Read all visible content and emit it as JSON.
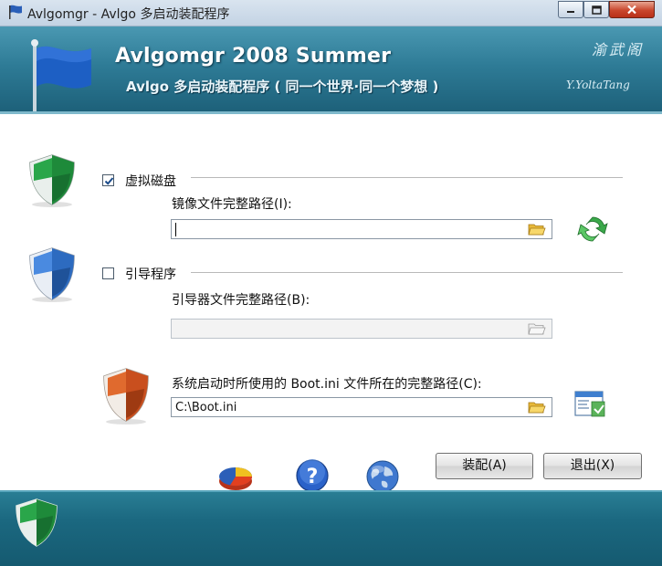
{
  "window": {
    "title": "Avlgomgr - Avlgo 多启动装配程序",
    "controls": [
      "minimize",
      "maximize",
      "close"
    ]
  },
  "banner": {
    "title": "Avlgomgr 2008 Summer",
    "subtitle": "Avlgo 多启动装配程序 ( 同一个世界·同一个梦想 )",
    "signature_cn": "渝武阁",
    "signature_en": "Y.YoltaTang"
  },
  "virtual_disk": {
    "label": "虚拟磁盘",
    "checked": true,
    "path_label": "镜像文件完整路径(I):",
    "path_value": ""
  },
  "boot_loader": {
    "label": "引导程序",
    "checked": false,
    "path_label": "引导器文件完整路径(B):",
    "path_value": ""
  },
  "boot_ini": {
    "path_label": "系统启动时所使用的 Boot.ini 文件所在的完整路径(C):",
    "path_value": "C:\\Boot.ini"
  },
  "buttons": {
    "assemble": "装配(A)",
    "exit": "退出(X)"
  },
  "icons": {
    "app": "flag-icon",
    "refresh": "refresh-icon",
    "edit_boot_ini": "edit-window-icon",
    "pie_chart": "pie-chart-icon",
    "help": "help-icon",
    "globe": "globe-icon"
  },
  "colors": {
    "banner": "#2e7b96",
    "footer": "#1b6880",
    "shield_green": "#1f8a3b",
    "shield_blue": "#2f6fc2",
    "shield_orange": "#c8521f"
  }
}
